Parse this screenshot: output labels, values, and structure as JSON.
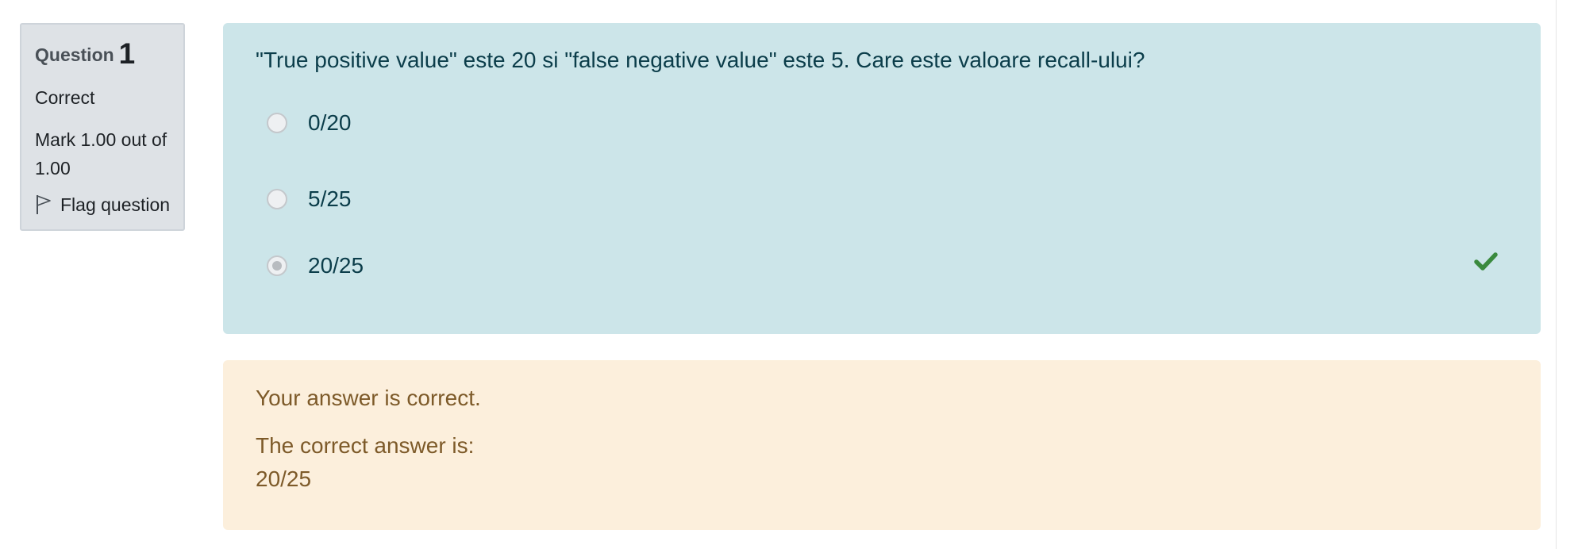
{
  "info": {
    "question_label": "Question",
    "question_number": "1",
    "state": "Correct",
    "grade": "Mark 1.00 out of 1.00",
    "flag_label": "Flag question"
  },
  "question": {
    "text": "\"True positive value\" este 20 si \"false negative value\" este 5. Care este valoare recall-ului?",
    "options": [
      {
        "label": "0/20",
        "selected": false
      },
      {
        "label": "5/25",
        "selected": false
      },
      {
        "label": "20/25",
        "selected": true
      }
    ],
    "correct_icon": "check-icon",
    "correct_color": "#3a8a3e"
  },
  "feedback": {
    "specific": "Your answer is correct.",
    "right_answer_label": "The correct answer is:",
    "right_answer_value": "20/25"
  }
}
